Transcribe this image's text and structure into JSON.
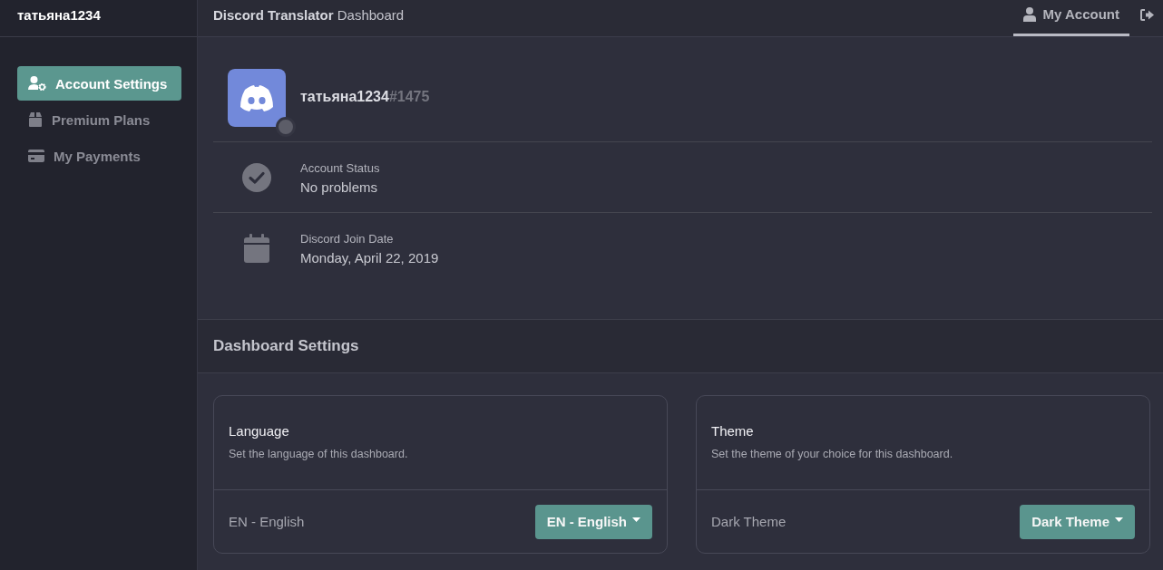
{
  "sidebar": {
    "brand": "татьяна1234",
    "items": [
      {
        "label": "Account Settings",
        "selected": true
      },
      {
        "label": "Premium Plans",
        "selected": false
      },
      {
        "label": "My Payments",
        "selected": false
      }
    ]
  },
  "header": {
    "title": "**Discord Translator** Dashboard",
    "nav": [
      {
        "label": "My Account",
        "selected": true
      }
    ]
  },
  "profile": {
    "username": "татьяна1234",
    "discriminator": "#1475",
    "details": [
      {
        "label": "Account Status",
        "value": "No problems"
      },
      {
        "label": "Discord Join Date",
        "value": "Monday, April 22, 2019"
      }
    ]
  },
  "dashboard_settings": {
    "title": "Dashboard Settings",
    "cards": [
      {
        "title": "Language",
        "description": "Set the language of this dashboard.",
        "current": "EN - English",
        "dropdown": "EN - English"
      },
      {
        "title": "Theme",
        "description": "Set the theme of your choice for this dashboard.",
        "current": "Dark Theme",
        "dropdown": "Dark Theme"
      }
    ]
  }
}
